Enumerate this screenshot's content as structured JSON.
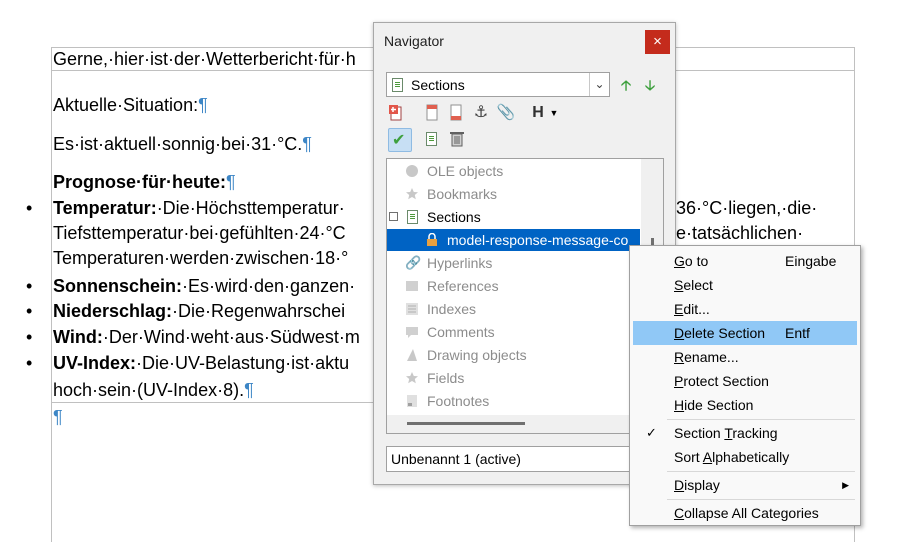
{
  "document": {
    "line1": "Gerne,·hier·ist·der·Wetterbericht·für·h",
    "heading_current": "Aktuelle·Situation:",
    "current_text": "Es·ist·aktuell·sonnig·bei·31·°C.",
    "heading_forecast": "Prognose·für·heute:",
    "bullets": [
      {
        "label": "Temperatur:",
        "text": "·Die·Höchsttemperatur·"
      },
      {
        "label": "Sonnenschein:",
        "text": "·Es·wird·den·ganzen·"
      },
      {
        "label": "Niederschlag:",
        "text": "·Die·Regenwahrschei"
      },
      {
        "label": "Wind:",
        "text": "·Der·Wind·weht·aus·Südwest·m"
      },
      {
        "label": "UV-Index:",
        "text": "·Die·UV-Belastung·ist·aktu"
      }
    ],
    "temp_right": "36·°C·liegen,·die·",
    "temp_line2_left": "Tiefsttemperatur·bei·gefühlten·24·°C",
    "temp_line2_right": "e·tatsächlichen·",
    "temp_line3": "Temperaturen·werden·zwischen·18·°",
    "uv_line2": "hoch·sein·(UV-Index·8).",
    "pilcrow": "¶"
  },
  "navigator": {
    "title": "Navigator",
    "close": "×",
    "category_select": "Sections",
    "tree": [
      {
        "label": "OLE objects",
        "state": "gray"
      },
      {
        "label": "Bookmarks",
        "state": "gray"
      },
      {
        "label": "Sections",
        "state": "normal"
      },
      {
        "label": "model-response-message-co",
        "state": "selected"
      },
      {
        "label": "Hyperlinks",
        "state": "gray"
      },
      {
        "label": "References",
        "state": "gray"
      },
      {
        "label": "Indexes",
        "state": "gray"
      },
      {
        "label": "Comments",
        "state": "gray"
      },
      {
        "label": "Drawing objects",
        "state": "gray"
      },
      {
        "label": "Fields",
        "state": "gray"
      },
      {
        "label": "Footnotes",
        "state": "gray"
      }
    ],
    "document_select": "Unbenannt 1 (active)"
  },
  "context_menu": {
    "items": [
      {
        "pre": "",
        "u": "G",
        "post": "o to",
        "accel": "Eingabe"
      },
      {
        "pre": "",
        "u": "S",
        "post": "elect",
        "accel": ""
      },
      {
        "pre": "",
        "u": "E",
        "post": "dit...",
        "accel": ""
      },
      {
        "pre": "",
        "u": "D",
        "post": "elete Section",
        "accel": "Entf"
      },
      {
        "pre": "",
        "u": "R",
        "post": "ename...",
        "accel": ""
      },
      {
        "pre": "",
        "u": "P",
        "post": "rotect Section",
        "accel": ""
      },
      {
        "pre": "",
        "u": "H",
        "post": "ide Section",
        "accel": ""
      },
      {
        "pre": "Section ",
        "u": "T",
        "post": "racking",
        "accel": ""
      },
      {
        "pre": "Sort ",
        "u": "A",
        "post": "lphabetically",
        "accel": ""
      },
      {
        "pre": "",
        "u": "D",
        "post": "isplay",
        "accel": ""
      },
      {
        "pre": "",
        "u": "C",
        "post": "ollapse All Categories",
        "accel": ""
      }
    ]
  },
  "colors": {
    "accent": "#0063c4",
    "highlight": "#90c8f6",
    "pilcrow": "#3d86c6",
    "close": "#c42b1c"
  },
  "icons": [
    "sections-icon",
    "up-arrow-icon",
    "down-arrow-icon",
    "insert-icon",
    "header-icon",
    "footer-icon",
    "anchor-icon",
    "attach-icon",
    "heading-level-icon",
    "check-icon",
    "delete-icon"
  ]
}
